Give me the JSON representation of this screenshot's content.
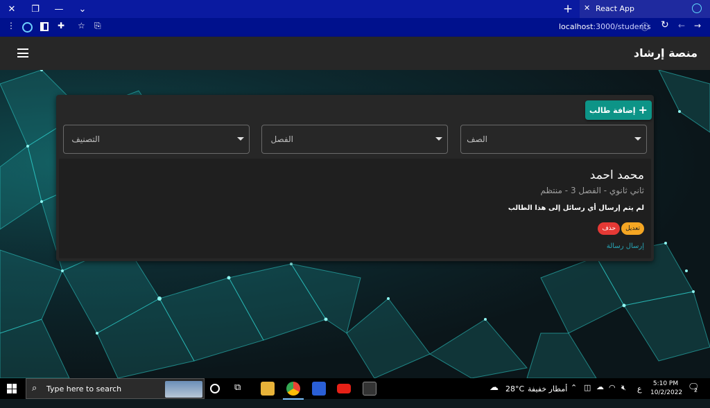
{
  "browser": {
    "tab_title": "React App",
    "url_host": "localhost",
    "url_path": ":3000/students"
  },
  "app": {
    "title": "منصة إرشاد"
  },
  "toolbar": {
    "add_student_label": "إضافة طالب"
  },
  "filters": {
    "grade_placeholder": "الصف",
    "class_placeholder": "الفصل",
    "category_placeholder": "التصنيف"
  },
  "student": {
    "name": "محمد احمد",
    "meta": "ثاني ثانوي - الفصل 3 - منتظم",
    "message_status": "لم يتم إرسال أي رسائل إلى هذا الطالب",
    "edit_label": "تعديل",
    "delete_label": "حذف",
    "send_message_label": "إرسال رسالة"
  },
  "taskbar": {
    "search_placeholder": "Type here to search",
    "weather_temp": "28°C",
    "weather_text": "أمطار خفيفة",
    "lang": "ع",
    "time": "5:10 PM",
    "date": "10/2/2022",
    "notifications": "2"
  },
  "colors": {
    "accent": "#0d9487",
    "edit": "#f5a623",
    "delete": "#e53935",
    "link": "#27a7b8",
    "appbar": "#272727"
  }
}
